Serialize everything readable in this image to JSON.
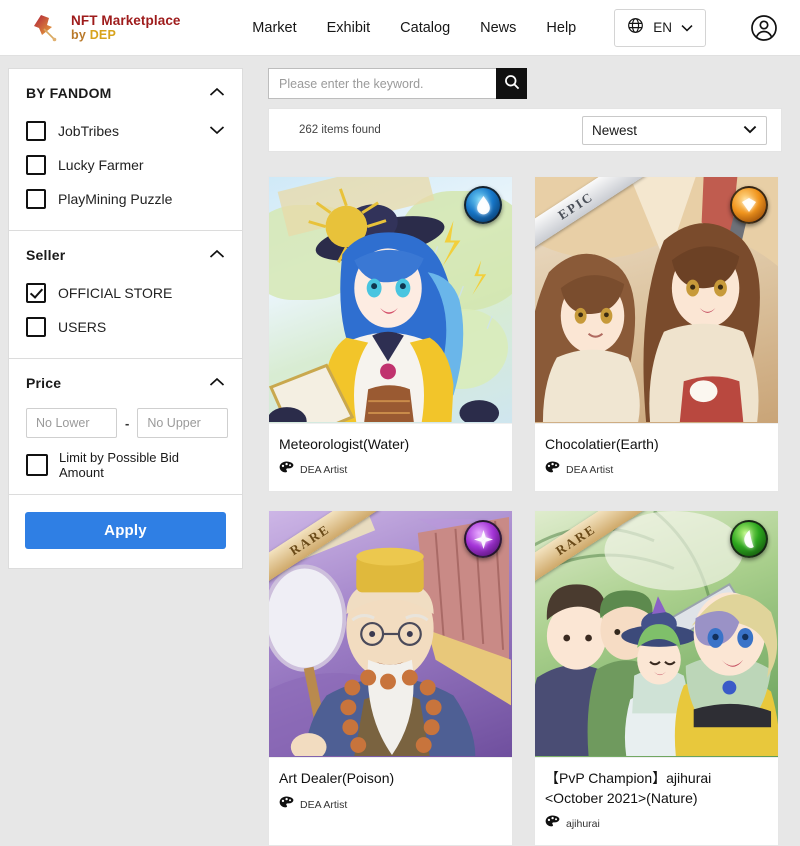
{
  "header": {
    "brand": {
      "title": "NFT Marketplace",
      "by": "by",
      "dep": "DEP"
    },
    "nav": [
      {
        "label": "Market"
      },
      {
        "label": "Exhibit"
      },
      {
        "label": "Catalog"
      },
      {
        "label": "News"
      },
      {
        "label": "Help"
      }
    ],
    "language": {
      "code": "EN",
      "icon": "globe-icon",
      "chevron": "chevron-down-icon"
    },
    "account_icon": "account-circle-icon"
  },
  "sidebar": {
    "sections": [
      {
        "title": "BY FANDOM",
        "collapse_icon": "chevron-up-icon",
        "options": [
          {
            "label": "JobTribes",
            "checked": false,
            "has_sub": true
          },
          {
            "label": "Lucky Farmer",
            "checked": false,
            "has_sub": false
          },
          {
            "label": "PlayMining Puzzle",
            "checked": false,
            "has_sub": false
          }
        ]
      },
      {
        "title": "Seller",
        "collapse_icon": "chevron-up-icon",
        "options": [
          {
            "label": "OFFICIAL STORE",
            "checked": true,
            "has_sub": false
          },
          {
            "label": "USERS",
            "checked": false,
            "has_sub": false
          }
        ]
      }
    ],
    "price": {
      "title": "Price",
      "collapse_icon": "chevron-up-icon",
      "lower_placeholder": "No Lower",
      "lower_value": "",
      "upper_placeholder": "No Upper",
      "upper_value": "",
      "separator": "-",
      "limit_label": "Limit by Possible Bid Amount",
      "limit_checked": false
    },
    "apply_label": "Apply",
    "apply_color": "#2f7fe4"
  },
  "search": {
    "placeholder": "Please enter the keyword.",
    "value": "",
    "button_icon": "search-icon"
  },
  "toolbar": {
    "items_found": "262 items found",
    "sort_value": "Newest",
    "sort_options": [
      "Newest"
    ],
    "chevron": "chevron-down-icon"
  },
  "cards": [
    {
      "title": "Meteorologist(Water)",
      "artist": "DEA Artist",
      "artist_icon": "palette-icon",
      "element": "water",
      "element_color": "#1676c8",
      "rarity": ""
    },
    {
      "title": "Chocolatier(Earth)",
      "artist": "DEA Artist",
      "artist_icon": "palette-icon",
      "element": "earth",
      "element_color": "#f0941c",
      "rarity": "EPIC"
    },
    {
      "title": "Art Dealer(Poison)",
      "artist": "DEA Artist",
      "artist_icon": "palette-icon",
      "element": "poison",
      "element_color": "#a333d6",
      "rarity": "RARE"
    },
    {
      "title": "【PvP Champion】ajihurai <October 2021>(Nature)",
      "artist": "ajihurai",
      "artist_icon": "palette-icon",
      "element": "nature",
      "element_color": "#2ca61e",
      "rarity": "RARE"
    }
  ]
}
